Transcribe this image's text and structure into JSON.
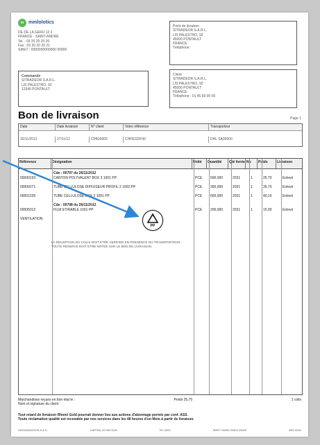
{
  "logo": {
    "mark": "m",
    "text": "mmlolotics"
  },
  "sender": {
    "lines": [
      "DE DE LA GERU 12 3",
      "FRANCE - SAINT-ANDRE",
      "Tel. : 03 20 20 20 20",
      "Fax : 03 20 20 20 21",
      "SIRET : 0000000000000 00000"
    ]
  },
  "ship_to": {
    "lines": [
      "Point de livraison",
      "SITRADEOR S.A.R.L.",
      "LIS PALESTRO, 92",
      "",
      "45000 PONTAULT",
      "FRANCE",
      "Téléphone :"
    ]
  },
  "client": {
    "heading": "Commande",
    "lines": [
      "SITRADEOR S.A.R.L.",
      "LIS PALESTRO, 92",
      "",
      "12345 PONTAULT"
    ]
  },
  "bill_to": {
    "lines": [
      "Client",
      "SITRADEOR S.A.R.L.",
      "LIS PALESTRO, 92",
      "",
      "45000 PONTAULT",
      "FRANCE",
      "Téléphone : 01 45 69 00 00"
    ]
  },
  "doc_title": "Bon de livraison",
  "page_label": "Page 1",
  "header_cols": [
    "Date",
    "Date livraison",
    "N° client",
    "Votre référence",
    "Transporteur"
  ],
  "header_vals": [
    "26/11/2012",
    "27/11/12",
    "CPA00000",
    "CHPEGDF00",
    "DHL SA00000"
  ],
  "columns": [
    "Référence",
    "Désignation",
    "Unité",
    "Quantité",
    "Qté livrée",
    "Nb",
    "Poids",
    "Livraison"
  ],
  "rows": [
    {
      "ref": "",
      "desc": "Cde : 00797 du 26/11/2012",
      "unit": "",
      "qty": "",
      "deliv": "",
      "nb": "",
      "weight": "",
      "status": ""
    },
    {
      "ref": "00000193",
      "desc": "CARTON POLYVALENT BOX 3 1001 PP",
      "unit": "PCE",
      "qty": "500,000",
      "deliv": "2031",
      "nb": "1",
      "weight": "25,70",
      "status": "Enlevé"
    },
    {
      "ref": "00000271",
      "desc": "TUBE CELLULOSE DIFFUSEUR PROFIL 2 1002 PP",
      "unit": "PCE",
      "qty": "300,000",
      "deliv": "2031",
      "nb": "1",
      "weight": "35,70",
      "status": "Enlevé"
    },
    {
      "ref": "00001235",
      "desc": "TUBE CELLULOSE BOX 3 1001 PP",
      "unit": "PCE",
      "qty": "600,000",
      "deliv": "2031",
      "nb": "1",
      "weight": "40,10",
      "status": "Enlevé"
    },
    {
      "ref": "",
      "desc": "Cde : 00798 du 26/11/2012",
      "unit": "",
      "qty": "",
      "deliv": "",
      "nb": "",
      "weight": "",
      "status": ""
    },
    {
      "ref": "00005012",
      "desc": "FILM ETIRABLE 1001 PP",
      "unit": "PCE",
      "qty": "200,000",
      "deliv": "2031",
      "nb": "1",
      "weight": "15,00",
      "status": "Enlevé"
    },
    {
      "ref": "VENTILATION",
      "desc": "",
      "unit": "",
      "qty": "",
      "deliv": "",
      "nb": "",
      "weight": "",
      "status": ""
    }
  ],
  "note": "LA RECEPTION DU COLIS DOIT ETRE VERIFIEE EN PRESENCE DU TRANSPORTEUR. TOUTE RESERVE DOIT ETRE NOTEE SUR LE BON DE LIVRAISON.",
  "footer": {
    "totals_label": "Marchandises reçues en bon état le :",
    "sign_label": "Nom et signature du client :",
    "weight": "Poids 25,70",
    "packages": "1 colis",
    "legal1": "Tout retard de livraison Rhoné Gold pourrait donner lieu aux actions d'abonnage permis par conf. ASS.",
    "legal2": "Toute réclamation qualité est recevable par nos services dans les 48 heures d'un Mois à partir de livraison.",
    "bottom": [
      "ORGANISATION S.A.S.",
      "CAPITAL 00 000 EUR",
      "RC 0000",
      "SIRET 00000 00000 00000",
      "APE 0000"
    ]
  },
  "overlay": {
    "icon": "recycle-icon",
    "badge_label": "PP",
    "accent": "#2f86d6"
  }
}
